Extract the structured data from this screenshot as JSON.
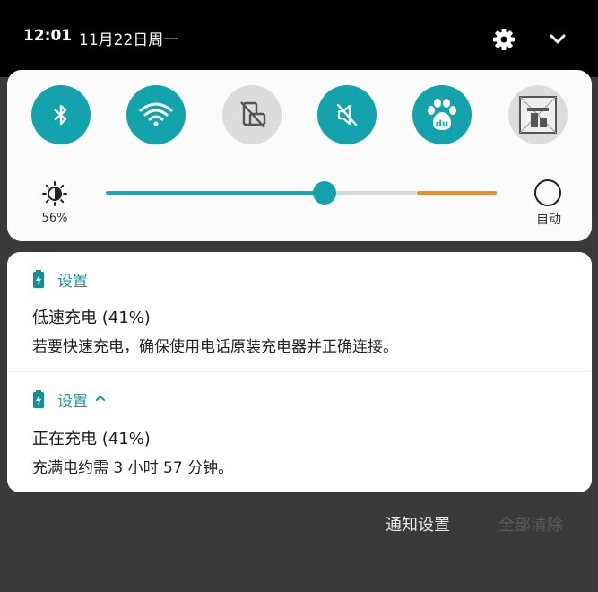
{
  "status_bar": {
    "time": "12:01",
    "date": "11月22日周一",
    "settings_icon": "gear-icon",
    "expand_icon": "chevron-down-icon"
  },
  "quick_settings": {
    "accent_color": "#14a2ad",
    "tiles": [
      {
        "name": "bluetooth",
        "icon": "bluetooth-icon",
        "state": "on"
      },
      {
        "name": "wifi",
        "icon": "wifi-icon",
        "state": "on"
      },
      {
        "name": "auto-rotate",
        "icon": "rotate-icon",
        "state": "off"
      },
      {
        "name": "mute",
        "icon": "mute-icon",
        "state": "on"
      },
      {
        "name": "baidu",
        "icon": "baidu-paw-icon",
        "state": "on"
      },
      {
        "name": "screenshot",
        "icon": "screenshot-icon",
        "state": "off"
      }
    ],
    "brightness": {
      "percent_label": "56%",
      "level": 0.56,
      "warn_start": 0.795,
      "auto_label": "自动"
    }
  },
  "notifications": [
    {
      "app": "设置",
      "title": "低速充电 (41%)",
      "body": "若要快速充电，确保使用电话原装充电器并正确连接。",
      "icon": "battery-charging-icon"
    },
    {
      "app": "设置",
      "app_suffix": "^",
      "title": "正在充电 (41%)",
      "body": "充满电约需 3 小时 57 分钟。",
      "icon": "battery-charging-icon"
    }
  ],
  "footer": {
    "settings_label": "通知设置",
    "clear_label": "全部清除"
  }
}
